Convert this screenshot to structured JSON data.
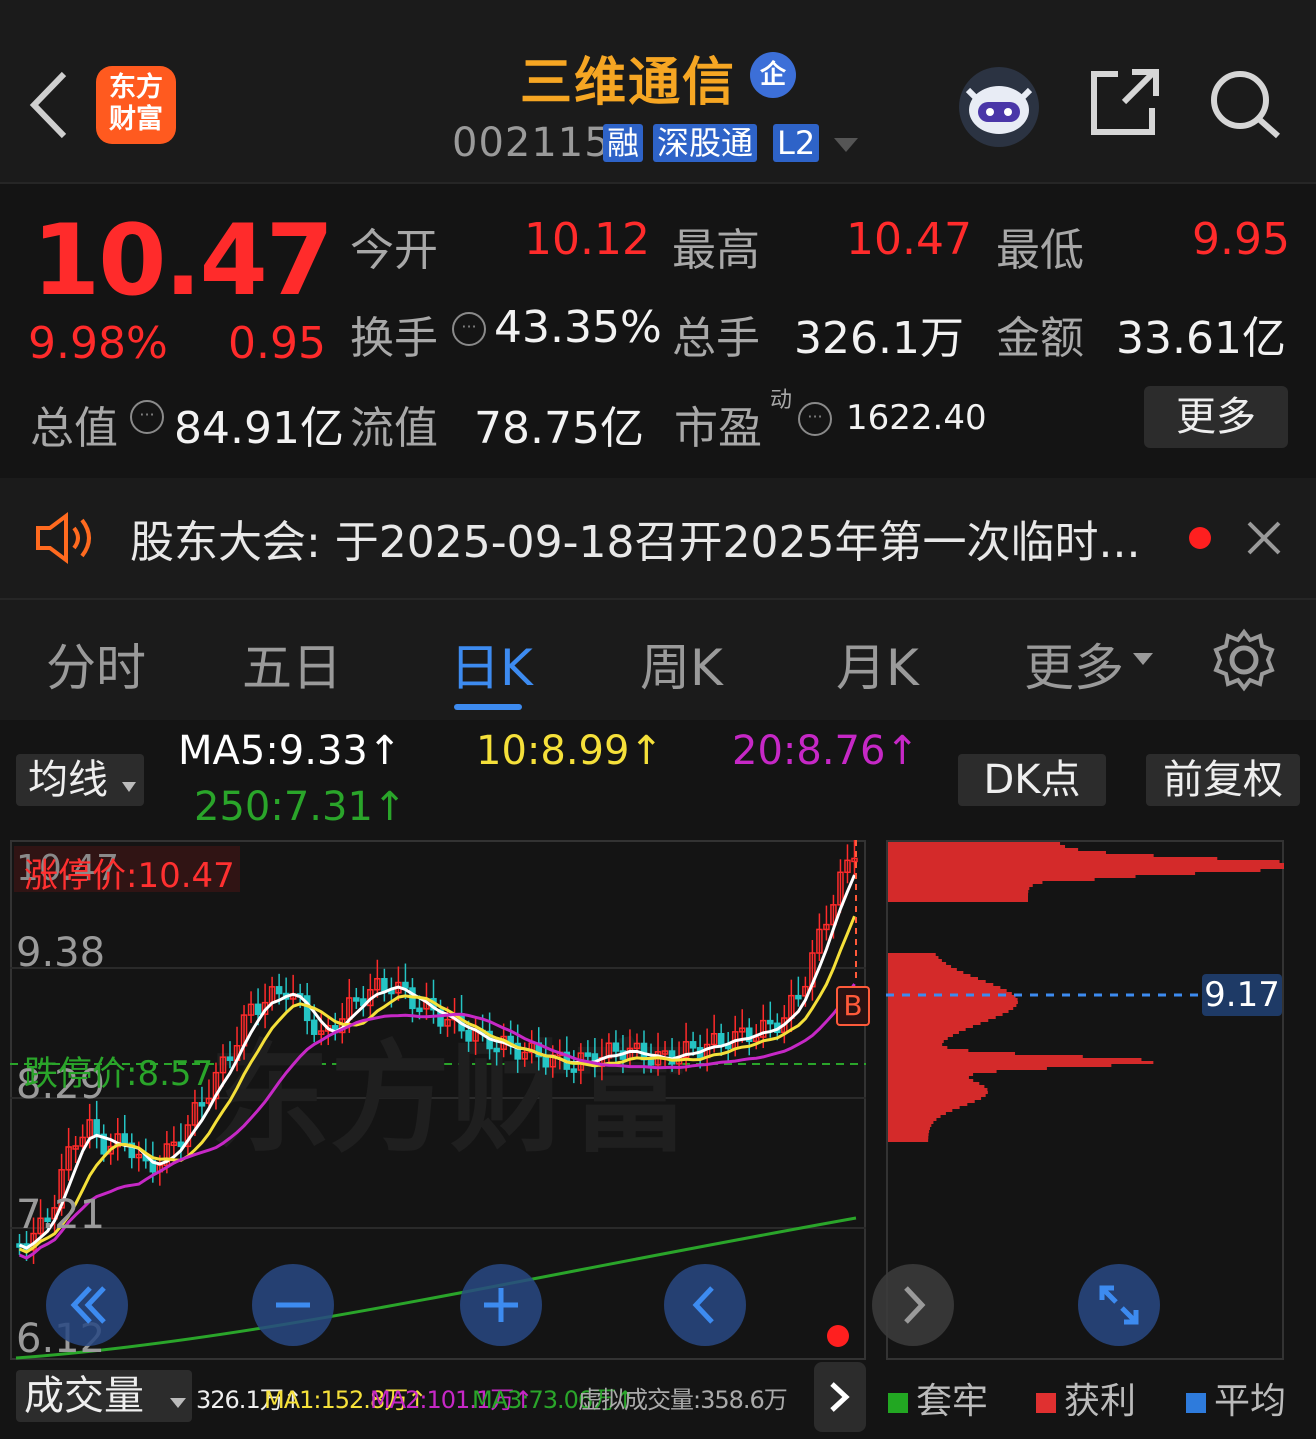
{
  "header": {
    "app_logo_line1": "东方",
    "app_logo_line2": "财富",
    "stock_name": "三维通信",
    "enterprise_badge": "企",
    "stock_code": "002115",
    "tags": [
      "融",
      "深股通",
      "L2"
    ]
  },
  "quote": {
    "price": "10.47",
    "change_pct": "9.98%",
    "change": "0.95",
    "open_label": "今开",
    "open": "10.12",
    "high_label": "最高",
    "high": "10.47",
    "low_label": "最低",
    "low": "9.95",
    "turnover_label": "换手",
    "turnover": "43.35%",
    "volume_label": "总手",
    "volume": "326.1万",
    "amount_label": "金额",
    "amount": "33.61亿",
    "mktcap_label": "总值",
    "mktcap": "84.91亿",
    "float_label": "流值",
    "float_cap": "78.75亿",
    "pe_label": "市盈",
    "pe_sup": "动",
    "pe": "1622.40",
    "more": "更多"
  },
  "notice": {
    "text": "股东大会:  于2025-09-18召开2025年第一次临时..."
  },
  "tabs": [
    "分时",
    "五日",
    "日K",
    "周K",
    "月K",
    "更多"
  ],
  "indicators": {
    "selector": "均线",
    "ma5": "MA5:9.33↑",
    "ma10": "10:8.99↑",
    "ma20": "20:8.76↑",
    "ma250": "250:7.31↑",
    "dk": "DK点",
    "adjust": "前复权"
  },
  "chart": {
    "limit_up": "涨停价:10.47",
    "limit_down": "跌停价:8.57",
    "price_labels": [
      "10.47",
      "9.38",
      "8.29",
      "7.21",
      "6.12"
    ],
    "b_marker": "B",
    "profile_price": "9.17",
    "watermark": "东方财富"
  },
  "volume": {
    "selector": "成交量",
    "vol": "326.1万↑",
    "ma1": "MA1:152.8万↑",
    "ma2": "MA2:101.1万↑",
    "ma3": "MA3:73.06万↑",
    "virtual": "虚拟成交量:358.6万"
  },
  "legend": [
    "套牢",
    "获利",
    "平均"
  ],
  "colors": {
    "up": "#ff2b2b",
    "down": "#25c4c4",
    "ma5": "#ffffff",
    "ma10": "#f5e03a",
    "ma20": "#c628c6",
    "ma250": "#2aa52a",
    "accent": "#3d8bf0",
    "title": "#f6a623"
  }
}
